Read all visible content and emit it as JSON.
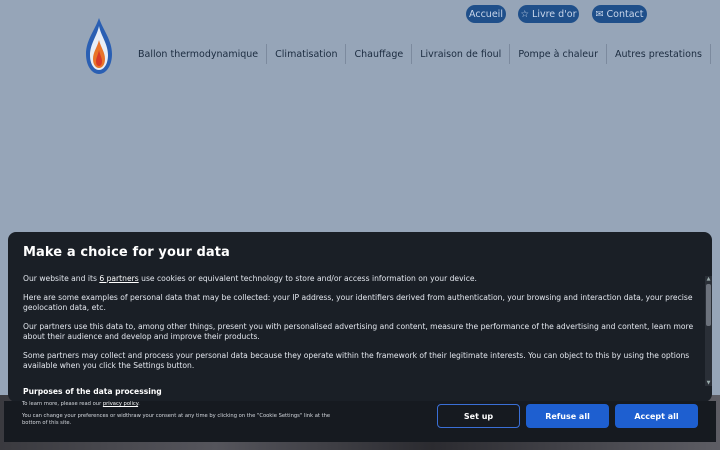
{
  "header": {
    "pills": [
      {
        "icon": "home",
        "label": "Accueil"
      },
      {
        "icon": "star-icon",
        "label": "Livre d'or"
      },
      {
        "icon": "mail-icon",
        "label": "Contact"
      }
    ],
    "nav": [
      "Ballon thermodynamique",
      "Climatisation",
      "Chauffage",
      "Livraison de fioul",
      "Pompe à chaleur",
      "Autres prestations"
    ]
  },
  "consent": {
    "title": "Make a choice for your data",
    "p1_prefix": "Our website and its",
    "p1_link": "6 partners",
    "p1_suffix": "use cookies or equivalent technology to store and/or access information on your device.",
    "p2": "Here are some examples of personal data that may be collected: your IP address, your identifiers derived from authentication, your browsing and interaction data, your precise geolocation data, etc.",
    "p3": "Our partners use this data to, among other things, present you with personalised advertising and content, measure the performance of the advertising and content, learn more about their audience and develop and improve their products.",
    "p4": "Some partners may collect and process your personal data because they operate within the framework of their legitimate interests. You can object to this by using the options available when you click the Settings button.",
    "purposes_heading": "Purposes of the data processing",
    "footer_prefix": "To learn more, please read our",
    "footer_link": "privacy policy",
    "footer_line2": "You can change your preferences or widthraw your consent at any time by clicking on the \"Cookie Settings\" link at the bottom of this site.",
    "buttons": {
      "setup": "Set up",
      "refuse": "Refuse all",
      "accept": "Accept all"
    }
  },
  "colors": {
    "page_bg": "#96a5b8",
    "pill_bg": "#1f4f8a",
    "modal_bg": "#1a1f26",
    "button_blue": "#1e5fd0"
  }
}
